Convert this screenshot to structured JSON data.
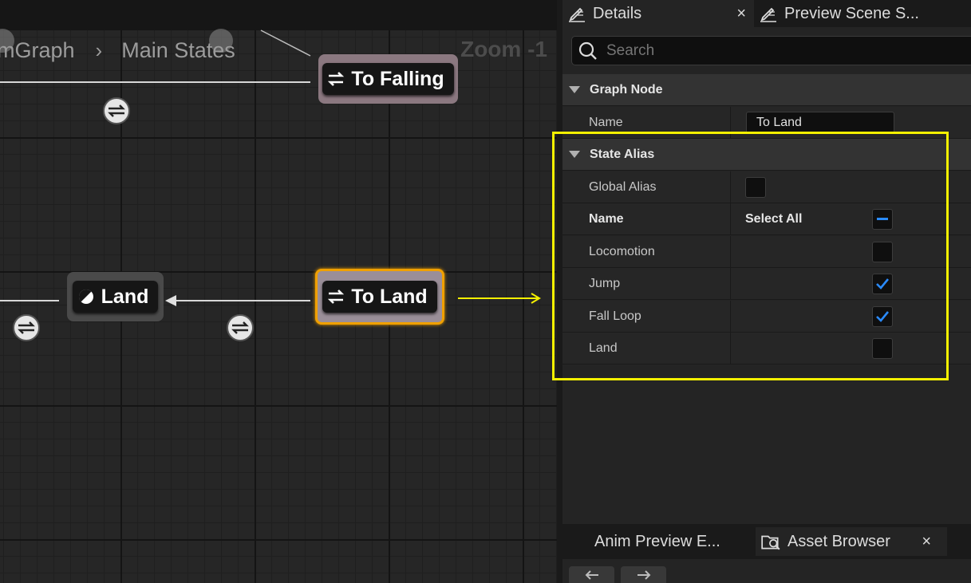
{
  "graph": {
    "breadcrumb": {
      "first": "mGraph",
      "separator": "›",
      "current": "Main States"
    },
    "zoom": "Zoom -1",
    "nodes": {
      "to_falling": "To Falling",
      "land": "Land",
      "to_land": "To Land"
    }
  },
  "details_panel": {
    "tabs": [
      {
        "label": "Details",
        "close": "×"
      },
      {
        "label": "Preview Scene S..."
      }
    ],
    "search": {
      "placeholder": "Search"
    },
    "graph_node": {
      "header": "Graph Node",
      "name_label": "Name",
      "name_value": "To Land"
    },
    "state_alias": {
      "header": "State Alias",
      "global_alias_label": "Global Alias",
      "global_alias_checked": false,
      "name_header": "Name",
      "select_all_label": "Select All",
      "select_all_state": "indeterminate",
      "states": [
        {
          "label": "Locomotion",
          "checked": false
        },
        {
          "label": "Jump",
          "checked": true
        },
        {
          "label": "Fall Loop",
          "checked": true
        },
        {
          "label": "Land",
          "checked": false
        }
      ]
    },
    "bottom_tabs": [
      {
        "label": "Anim Preview E..."
      },
      {
        "label": "Asset Browser",
        "close": "×"
      }
    ]
  },
  "colors": {
    "highlight": "#f5f000",
    "selection_outline": "#f0a000",
    "check": "#2a8bff"
  }
}
